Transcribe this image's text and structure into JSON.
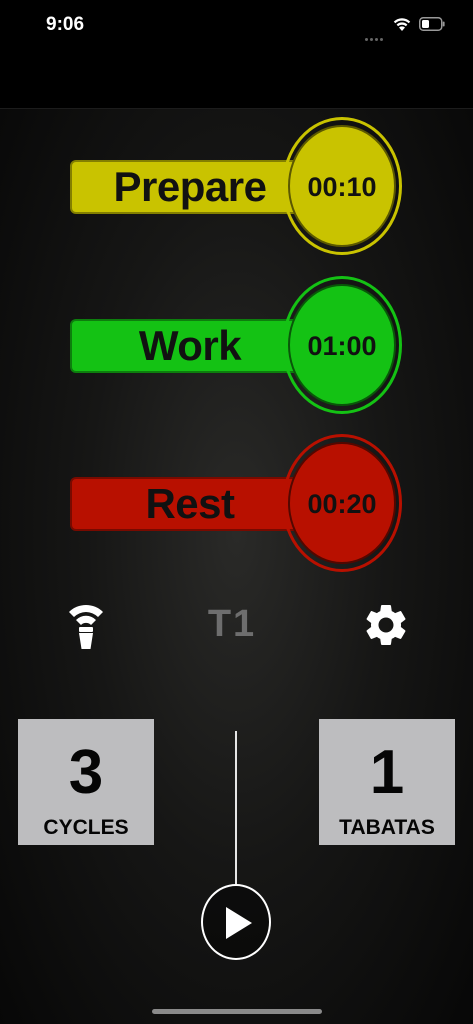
{
  "status_bar": {
    "time": "9:06",
    "signal_icon": "signal-dots-icon",
    "wifi_icon": "wifi-icon",
    "battery_icon": "battery-icon"
  },
  "timers": [
    {
      "label": "Prepare",
      "value": "00:10",
      "color": "#c9c300"
    },
    {
      "label": "Work",
      "value": "01:00",
      "color": "#14c214"
    },
    {
      "label": "Rest",
      "value": "00:20",
      "color": "#b81000"
    }
  ],
  "toolbar": {
    "sound_icon": "sound-beacon-icon",
    "preset_label": "T1",
    "settings_icon": "gear-icon"
  },
  "counters": {
    "cycles": {
      "value": "3",
      "label": "CYCLES"
    },
    "tabatas": {
      "value": "1",
      "label": "TABATAS"
    }
  },
  "play": {
    "icon": "play-icon"
  },
  "colors": {
    "background": "#161615",
    "counter_bg": "#bdbdbf",
    "preset_text": "#6e6e6e"
  }
}
